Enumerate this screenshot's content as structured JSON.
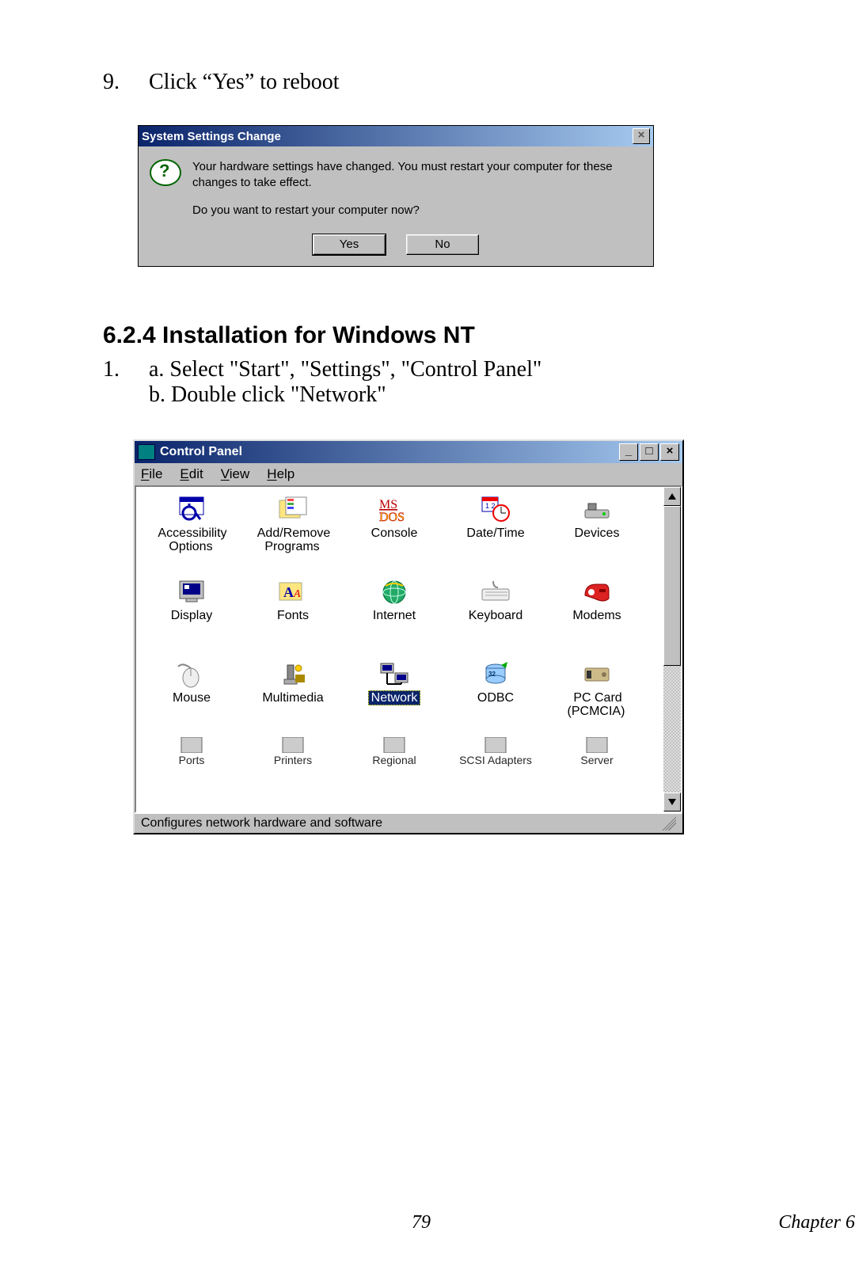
{
  "step9": {
    "num": "9.",
    "text": "Click “Yes” to reboot"
  },
  "dialog1": {
    "title": "System Settings Change",
    "line1": "Your hardware settings have changed. You must restart your computer for these changes to take effect.",
    "line2": "Do you want to restart your computer now?",
    "yes": "Yes",
    "no": "No"
  },
  "section": {
    "heading": "6.2.4 Installation for Windows NT"
  },
  "step1": {
    "num": "1.",
    "a": "a. Select \"Start\", \"Settings\", \"Control Panel\"",
    "b": "b. Double click \"Network\""
  },
  "cp": {
    "title": "Control Panel",
    "menu": {
      "file": "File",
      "edit": "Edit",
      "view": "View",
      "help": "Help"
    },
    "status": "Configures network hardware and software",
    "icons": [
      {
        "label": "Accessibility\nOptions",
        "name": "accessibility-options"
      },
      {
        "label": "Add/Remove\nPrograms",
        "name": "add-remove-programs"
      },
      {
        "label": "Console",
        "name": "console"
      },
      {
        "label": "Date/Time",
        "name": "date-time"
      },
      {
        "label": "Devices",
        "name": "devices"
      },
      {
        "label": "Display",
        "name": "display"
      },
      {
        "label": "Fonts",
        "name": "fonts"
      },
      {
        "label": "Internet",
        "name": "internet"
      },
      {
        "label": "Keyboard",
        "name": "keyboard"
      },
      {
        "label": "Modems",
        "name": "modems"
      },
      {
        "label": "Mouse",
        "name": "mouse"
      },
      {
        "label": "Multimedia",
        "name": "multimedia"
      },
      {
        "label": "Network",
        "name": "network",
        "selected": true
      },
      {
        "label": "ODBC",
        "name": "odbc"
      },
      {
        "label": "PC Card\n(PCMCIA)",
        "name": "pc-card"
      }
    ],
    "truncated": [
      {
        "label": "Ports",
        "name": "ports"
      },
      {
        "label": "Printers",
        "name": "printers"
      },
      {
        "label": "Regional",
        "name": "regional"
      },
      {
        "label": "SCSI Adapters",
        "name": "scsi-adapters"
      },
      {
        "label": "Server",
        "name": "server"
      }
    ]
  },
  "footer": {
    "page": "79",
    "chapter": "Chapter 6"
  }
}
